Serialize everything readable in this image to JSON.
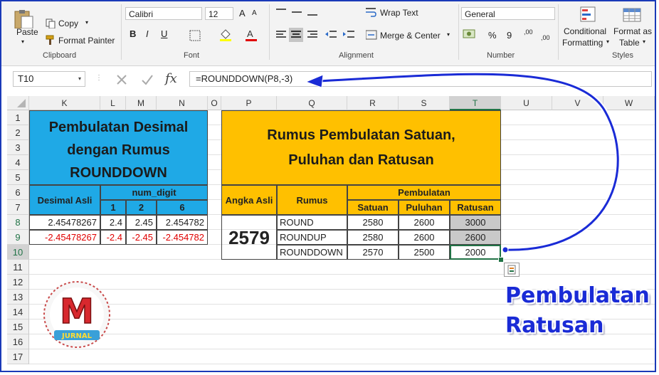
{
  "ribbon": {
    "clipboard": {
      "paste": "Paste",
      "copy": "Copy",
      "format_painter": "Format Painter",
      "label": "Clipboard"
    },
    "font": {
      "name": "Calibri",
      "size": "12",
      "grow": "A",
      "shrink": "A",
      "bold": "B",
      "italic": "I",
      "underline": "U",
      "label": "Font"
    },
    "alignment": {
      "wrap_text": "Wrap Text",
      "merge_center": "Merge & Center",
      "label": "Alignment"
    },
    "number": {
      "format": "General",
      "percent": "%",
      "comma": "9",
      "inc_dec": ",00",
      "dec_dec": ",00",
      "label": "Number"
    },
    "styles": {
      "conditional_1": "Conditional",
      "conditional_2": "Formatting",
      "format_as_1": "Format as",
      "format_as_2": "Table",
      "label": "Styles"
    }
  },
  "formula_bar": {
    "name_box": "T10",
    "fx": "fx",
    "formula": "=ROUNDDOWN(P8,-3)"
  },
  "columns": [
    "K",
    "L",
    "M",
    "N",
    "O",
    "P",
    "Q",
    "R",
    "S",
    "T",
    "U",
    "V",
    "W"
  ],
  "selected_column": "T",
  "rows": [
    "1",
    "2",
    "3",
    "4",
    "5",
    "6",
    "7",
    "8",
    "9",
    "10",
    "11",
    "12",
    "13",
    "14",
    "15",
    "16",
    "17"
  ],
  "selected_row": "10",
  "left_table": {
    "title_1": "Pembulatan Desimal",
    "title_2": "dengan Rumus",
    "title_3": "ROUNDDOWN",
    "col_desimal": "Desimal Asli",
    "col_num_digit": "num_digit",
    "digits": [
      "1",
      "2",
      "6"
    ],
    "row8": [
      "2.45478267",
      "2.4",
      "2.45",
      "2.454782"
    ],
    "row9": [
      "-2.45478267",
      "-2.4",
      "-2.45",
      "-2.454782"
    ]
  },
  "right_table": {
    "title_1": "Rumus Pembulatan Satuan,",
    "title_2": "Puluhan dan Ratusan",
    "col_angka": "Angka Asli",
    "col_rumus": "Rumus",
    "col_pembulatan": "Pembulatan",
    "sub_cols": [
      "Satuan",
      "Puluhan",
      "Ratusan"
    ],
    "angka": "2579",
    "rows": [
      {
        "rumus": "ROUND",
        "satuan": "2580",
        "puluhan": "2600",
        "ratusan": "3000"
      },
      {
        "rumus": "ROUNDUP",
        "satuan": "2580",
        "puluhan": "2600",
        "ratusan": "2600"
      },
      {
        "rumus": "ROUNDDOWN",
        "satuan": "2570",
        "puluhan": "2500",
        "ratusan": "2000"
      }
    ]
  },
  "callout": {
    "line1": "Pembulatan",
    "line2": "Ratusan"
  },
  "logo": {
    "letter": "M",
    "text": "JURNAL"
  },
  "colors": {
    "blue_header": "#1fa9e6",
    "gold_header": "#ffc000",
    "negative": "#e00000",
    "callout": "#1a2bd6",
    "frame": "#1a3ab8"
  }
}
